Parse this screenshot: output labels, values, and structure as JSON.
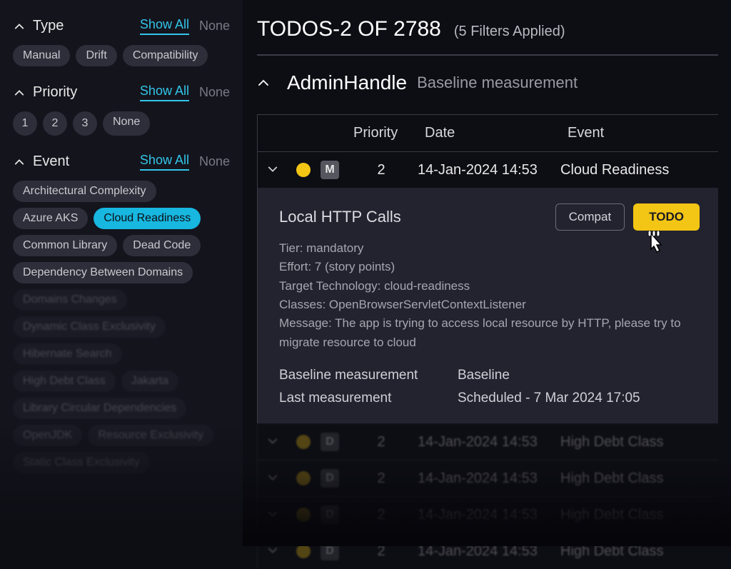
{
  "sidebar": {
    "sections": [
      {
        "title": "Type",
        "show_all": "Show All",
        "none": "None",
        "chips": [
          {
            "label": "Manual",
            "selected": false
          },
          {
            "label": "Drift",
            "selected": false
          },
          {
            "label": "Compatibility",
            "selected": false
          }
        ]
      },
      {
        "title": "Priority",
        "show_all": "Show All",
        "none": "None",
        "round_chips": [
          "1",
          "2",
          "3"
        ],
        "extra_chip": "None"
      },
      {
        "title": "Event",
        "show_all": "Show All",
        "none": "None",
        "chips": [
          {
            "label": "Architectural Complexity",
            "faded": false
          },
          {
            "label": "Azure AKS",
            "faded": false
          },
          {
            "label": "Cloud Readiness",
            "faded": false,
            "selected": true
          },
          {
            "label": "Common Library",
            "faded": false
          },
          {
            "label": "Dead Code",
            "faded": false
          },
          {
            "label": "Dependency Between Domains",
            "faded": false
          },
          {
            "label": "Domains Changes",
            "faded": true
          },
          {
            "label": "Dynamic Class Exclusivity",
            "faded": true
          },
          {
            "label": "Hibernate Search",
            "faded": true
          },
          {
            "label": "High Debt Class",
            "faded": true
          },
          {
            "label": "Jakarta",
            "faded": true
          },
          {
            "label": "Library Circular Dependencies",
            "faded": true
          },
          {
            "label": "OpenJDK",
            "faded": true
          },
          {
            "label": "Resource Exclusivity",
            "faded": true
          },
          {
            "label": "Static Class Exclusivity",
            "faded": true
          }
        ]
      }
    ]
  },
  "main": {
    "title": "TODOS-2 OF 2788",
    "filters_applied": "(5 Filters Applied)",
    "entity": {
      "name": "AdminHandle",
      "sub": "Baseline measurement"
    },
    "columns": {
      "c1": "Priority",
      "c2": "Date",
      "c3": "Event"
    },
    "rows": [
      {
        "tag": "M",
        "priority": "2",
        "date": "14-Jan-2024 14:53",
        "event": "Cloud Readiness",
        "expanded": true
      },
      {
        "tag": "D",
        "priority": "2",
        "date": "14-Jan-2024 14:53",
        "event": "High Debt Class"
      },
      {
        "tag": "D",
        "priority": "2",
        "date": "14-Jan-2024 14:53",
        "event": "High Debt Class"
      },
      {
        "tag": "D",
        "priority": "2",
        "date": "14-Jan-2024 14:53",
        "event": "High Debt Class"
      },
      {
        "tag": "D",
        "priority": "2",
        "date": "14-Jan-2024 14:53",
        "event": "High Debt Class"
      }
    ],
    "detail": {
      "title": "Local HTTP Calls",
      "compat_btn": "Compat",
      "todo_btn": "TODO",
      "tier": "Tier: mandatory",
      "effort": "Effort: 7 (story points)",
      "target_tech": "Target Technology: cloud-readiness",
      "classes": "Classes: OpenBrowserServletContextListener",
      "message": "Message: The app is trying to access local resource by HTTP, please try to migrate resource to cloud",
      "baseline_lbl": "Baseline measurement",
      "baseline_val": "Baseline",
      "last_lbl": "Last measurement",
      "last_val": "Scheduled - 7 Mar 2024 17:05"
    }
  }
}
